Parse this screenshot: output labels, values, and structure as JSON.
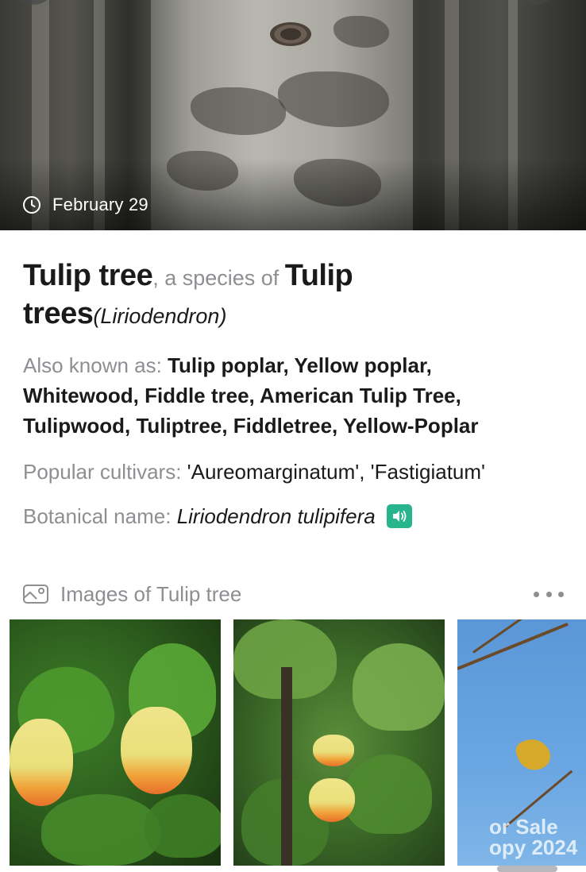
{
  "hero": {
    "date_text": "February 29"
  },
  "title": {
    "name": "Tulip tree",
    "connector": ", a species of ",
    "genus_common_part1": "Tulip",
    "genus_common_part2": "trees",
    "genus_latin": "(Liriodendron)"
  },
  "facts": {
    "aka_key": "Also known as: ",
    "aka_line1": "Tulip poplar, Yellow poplar,",
    "aka_line2": "Whitewood, Fiddle tree, American Tulip Tree,",
    "aka_line3": "Tulipwood, Tuliptree, Fiddletree, Yellow-Poplar",
    "cultivars_key": "Popular cultivars: ",
    "cultivars_value": "'Aureomarginatum', 'Fastigiatum'",
    "botanical_key": "Botanical name: ",
    "botanical_value": "Liriodendron tulipifera"
  },
  "images": {
    "heading": "Images of Tulip tree",
    "items": [
      {
        "icon": "photo"
      },
      {
        "icon": "photo"
      },
      {
        "icon": "photo",
        "watermark_line1": "or Sale",
        "watermark_line2": "opy 2024"
      }
    ]
  },
  "colors": {
    "accent_speaker": "#28b48c",
    "secondary_text": "#8e8e93",
    "primary_text": "#1a1a1a"
  }
}
